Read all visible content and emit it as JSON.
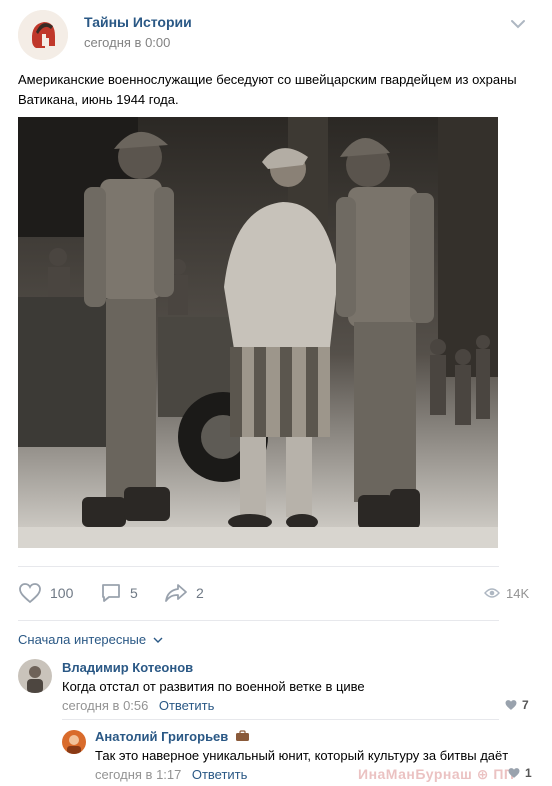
{
  "post": {
    "group_name": "Тайны Истории",
    "time": "сегодня в 0:00",
    "text": "Американские военнослужащие беседуют со швейцарским гвардейцем из охраны Ватикана, июнь 1944 года."
  },
  "actions": {
    "likes": "100",
    "comments": "5",
    "shares": "2",
    "views": "14K"
  },
  "comments_sort": "Сначала интересные",
  "comments": [
    {
      "author": "Владимир Котеонов",
      "text": "Когда отстал от развития по военной ветке в циве",
      "time": "сегодня в 0:56",
      "reply_label": "Ответить",
      "likes": "7"
    },
    {
      "author": "Анатолий Григорьев",
      "author_badge_icon": "briefcase-icon",
      "text": "Так это наверное уникальный юнит, который культуру за битвы даёт",
      "time": "сегодня в 1:17",
      "reply_label": "Ответить",
      "likes": "1"
    }
  ],
  "watermark": "ИнаМанБурнаш ⊕ ПП",
  "colors": {
    "link": "#2a5885",
    "meta": "#828282",
    "icon": "#99a2ad",
    "separator": "#e7e8ec"
  }
}
